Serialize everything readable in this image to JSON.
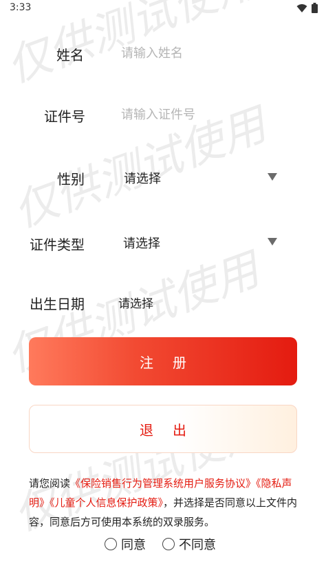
{
  "status_bar": {
    "time": "3:33",
    "icons": [
      "wifi-icon",
      "battery-icon"
    ]
  },
  "watermark": {
    "text": "仅供测试使用"
  },
  "form": {
    "name": {
      "label": "姓名",
      "placeholder": "请输入姓名",
      "value": ""
    },
    "id_number": {
      "label": "证件号",
      "placeholder": "请输入证件号",
      "value": ""
    },
    "gender": {
      "label": "性别",
      "value": "请选择"
    },
    "id_type": {
      "label": "证件类型",
      "value": "请选择"
    },
    "birth_date": {
      "label": "出生日期",
      "value": "请选择"
    }
  },
  "buttons": {
    "register": "注册",
    "exit": "退出"
  },
  "agreement": {
    "prefix": "请您阅读",
    "link1": "《保险销售行为管理系统用户服务协议》",
    "link2": "《隐私声明》",
    "link3": "《儿童个人信息保护政策》",
    "suffix": "，并选择是否同意以上文件内容，同意后方可使用本系统的双录服务。"
  },
  "consent": {
    "agree": "同意",
    "disagree": "不同意"
  },
  "colors": {
    "accent": "#e41b10",
    "placeholder": "#b5b5b5"
  }
}
